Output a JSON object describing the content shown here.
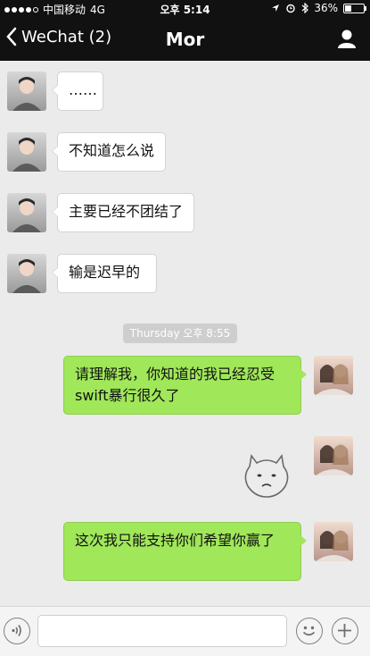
{
  "status_bar": {
    "carrier": "中国移动",
    "network": "4G",
    "time": "오후 5:14",
    "battery_percent": "36%",
    "battery_level": 0.36
  },
  "nav": {
    "back_label": "WeChat (2)",
    "title": "Mor"
  },
  "messages": [
    {
      "direction": "in",
      "text": "……"
    },
    {
      "direction": "in",
      "text": "不知道怎么说"
    },
    {
      "direction": "in",
      "text": "主要已经不团结了"
    },
    {
      "direction": "in",
      "text": "输是迟早的"
    },
    {
      "direction": "out",
      "text": "请理解我，你知道的我已经忍受swift暴行很久了"
    },
    {
      "direction": "out",
      "type": "sticker"
    },
    {
      "direction": "out",
      "text": "这次我只能支持你们希望你赢了"
    }
  ],
  "timestamp": "Thursday 오후 8:55",
  "input_bar": {
    "text_value": "",
    "icons": [
      "voice-icon",
      "emoji-icon",
      "plus-icon"
    ]
  },
  "colors": {
    "top_bar": "#111111",
    "outgoing_bubble": "#a0e75a",
    "incoming_bubble": "#ffffff",
    "chat_background": "#ebebeb"
  }
}
